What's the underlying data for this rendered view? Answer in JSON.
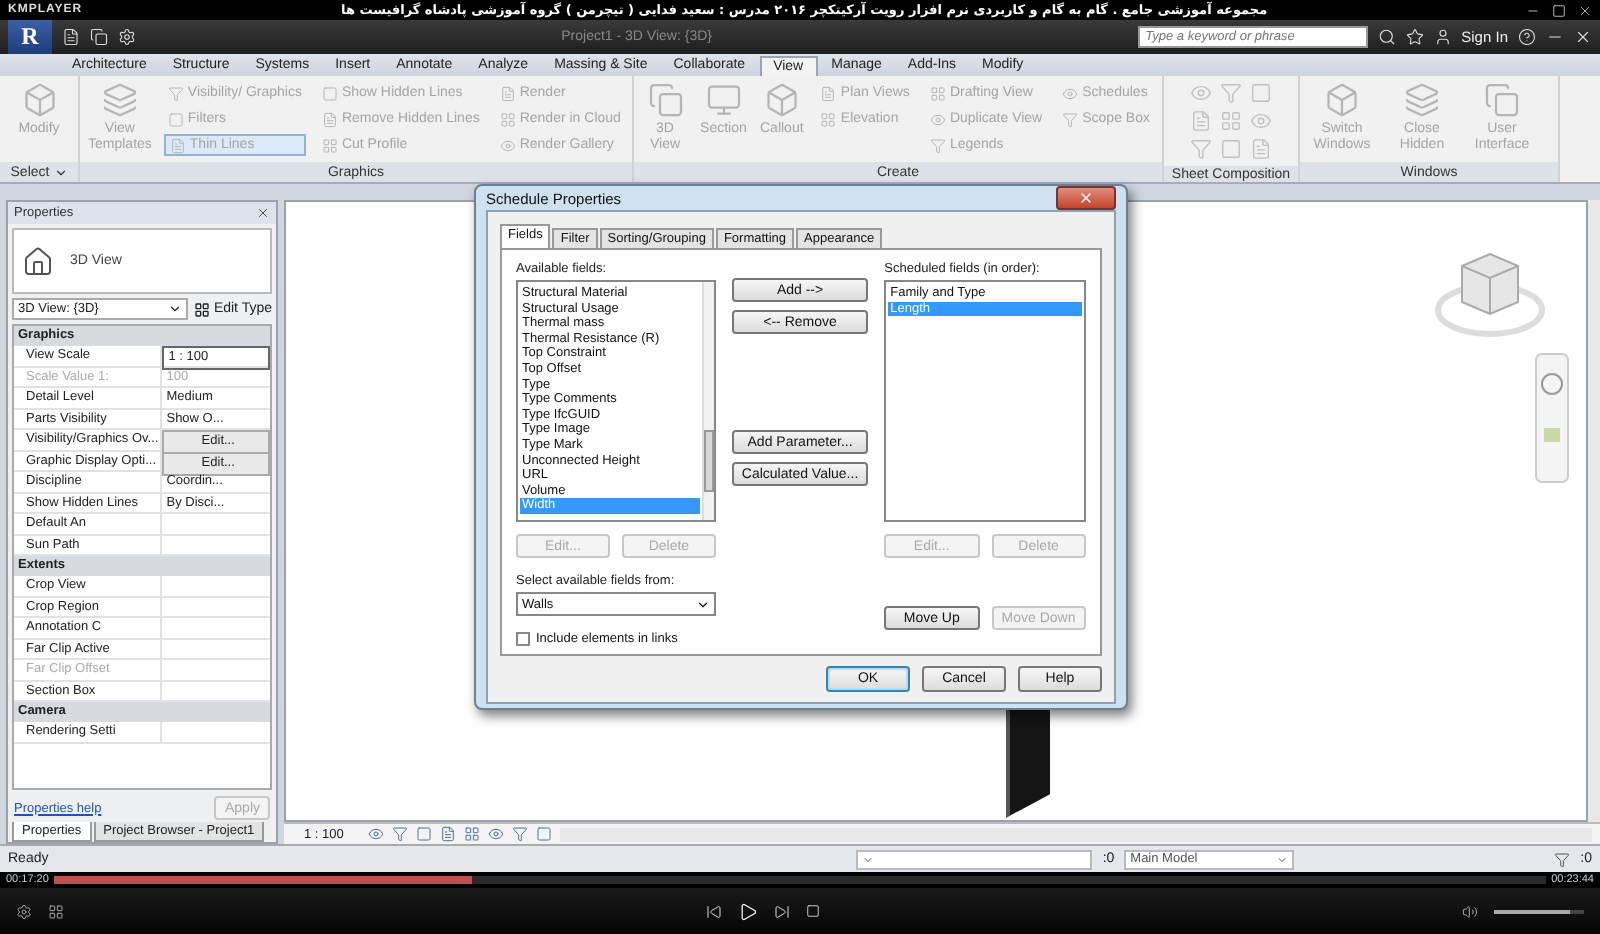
{
  "player": {
    "brand": "KMPLAYER",
    "title": "مجموعه آموزشی جامع . گام به گام و کاربردی نرم افزار رویت آرکیتکچر ۲۰۱۶   مدرس : سعید فدایی ( تیچرمن ) گروه آموزشی پادشاه گرافیست ها",
    "elapsed": "00:17:20",
    "total": "00:23:44",
    "progress": {
      "level": 0.28
    },
    "volume": {
      "level": 0.85
    }
  },
  "app": {
    "menu_letter": "R",
    "document_title": "Project1 - 3D View: {3D}",
    "search": {
      "placeholder": "Type a keyword or phrase"
    },
    "sign_in": "Sign In"
  },
  "tabs": [
    {
      "label": "Architecture",
      "selected": false
    },
    {
      "label": "Structure",
      "selected": false
    },
    {
      "label": "Systems",
      "selected": false
    },
    {
      "label": "Insert",
      "selected": false
    },
    {
      "label": "Annotate",
      "selected": false
    },
    {
      "label": "Analyze",
      "selected": false
    },
    {
      "label": "Massing & Site",
      "selected": false
    },
    {
      "label": "Collaborate",
      "selected": false
    },
    {
      "label": "View",
      "selected": true
    },
    {
      "label": "Manage",
      "selected": false
    },
    {
      "label": "Add-Ins",
      "selected": false
    },
    {
      "label": "Modify",
      "selected": false
    }
  ],
  "ribbon": {
    "panels": [
      {
        "label": "Select",
        "has_menu": true,
        "tools": [
          {
            "kind": "large",
            "items": [
              {
                "label": "Modify",
                "selected": false
              }
            ]
          }
        ]
      },
      {
        "label": "Graphics",
        "has_menu": false,
        "tools": [
          {
            "kind": "large",
            "items": [
              {
                "label": "View Templates",
                "selected": false
              }
            ]
          },
          {
            "kind": "stack",
            "items": [
              {
                "label": "Visibility/ Graphics",
                "selected": false
              },
              {
                "label": "Filters",
                "selected": false
              },
              {
                "label": "Thin  Lines",
                "selected": true
              }
            ]
          },
          {
            "kind": "stack",
            "items": [
              {
                "label": "Show  Hidden Lines",
                "selected": false
              },
              {
                "label": "Remove  Hidden Lines",
                "selected": false
              },
              {
                "label": "Cut  Profile",
                "selected": false
              }
            ]
          },
          {
            "kind": "stack",
            "items": [
              {
                "label": "Render",
                "selected": false
              },
              {
                "label": "Render  in Cloud",
                "selected": false
              },
              {
                "label": "Render  Gallery",
                "selected": false
              }
            ]
          }
        ]
      },
      {
        "label": "Create",
        "has_menu": false,
        "tools": [
          {
            "kind": "large",
            "items": [
              {
                "label": "3D View",
                "selected": false
              }
            ]
          },
          {
            "kind": "large",
            "items": [
              {
                "label": "Section",
                "selected": false
              }
            ]
          },
          {
            "kind": "large",
            "items": [
              {
                "label": "Callout",
                "selected": false
              }
            ]
          },
          {
            "kind": "stack",
            "items": [
              {
                "label": "Plan Views",
                "selected": false
              },
              {
                "label": "Elevation",
                "selected": false
              }
            ]
          },
          {
            "kind": "stack",
            "items": [
              {
                "label": "Drafting  View",
                "selected": false
              },
              {
                "label": "Duplicate  View",
                "selected": false
              },
              {
                "label": "Legends",
                "selected": false
              }
            ]
          },
          {
            "kind": "stack",
            "items": [
              {
                "label": "Schedules",
                "selected": false
              },
              {
                "label": "Scope Box",
                "selected": false
              }
            ]
          }
        ]
      },
      {
        "label": "Sheet Composition",
        "has_menu": false
      },
      {
        "label": "Windows",
        "has_menu": false,
        "tools": [
          {
            "kind": "large",
            "items": [
              {
                "label": "Switch Windows",
                "selected": false
              }
            ]
          },
          {
            "kind": "large",
            "items": [
              {
                "label": "Close Hidden",
                "selected": false
              }
            ]
          },
          {
            "kind": "large",
            "items": [
              {
                "label": "User Interface",
                "selected": false
              }
            ]
          }
        ]
      }
    ]
  },
  "properties": {
    "title": "Properties",
    "type_name": "3D View",
    "instance": "3D View: {3D}",
    "edit_type": "Edit Type",
    "groups": [
      {
        "label": "Graphics",
        "rows": [
          {
            "label": "View Scale",
            "value": "1 : 100",
            "kind": "field",
            "disabled": false
          },
          {
            "label": "Scale Value    1:",
            "value": "100",
            "kind": "text",
            "disabled": true
          },
          {
            "label": "Detail Level",
            "value": "Medium",
            "kind": "text",
            "disabled": false
          },
          {
            "label": "Parts Visibility",
            "value": "Show O...",
            "kind": "text",
            "disabled": false
          },
          {
            "label": "Visibility/Graphics Ov...",
            "value": "Edit...",
            "kind": "button",
            "disabled": false
          },
          {
            "label": "Graphic Display Opti...",
            "value": "Edit...",
            "kind": "button",
            "disabled": false
          },
          {
            "label": "Discipline",
            "value": "Coordin...",
            "kind": "text",
            "disabled": false
          },
          {
            "label": "Show Hidden Lines",
            "value": "By Disci...",
            "kind": "text",
            "disabled": false
          },
          {
            "label": "Default An",
            "disabled": false
          },
          {
            "label": "Sun Path",
            "disabled": false
          }
        ]
      },
      {
        "label": "Extents",
        "rows": [
          {
            "label": "Crop View",
            "disabled": false
          },
          {
            "label": "Crop Region",
            "disabled": false
          },
          {
            "label": "Annotation C",
            "disabled": false
          },
          {
            "label": "Far Clip Active",
            "disabled": false
          },
          {
            "label": "Far Clip Offset",
            "disabled": true
          },
          {
            "label": "Section Box",
            "disabled": false
          }
        ]
      },
      {
        "label": "Camera",
        "rows": [
          {
            "label": "Rendering Setti",
            "disabled": false
          }
        ]
      }
    ],
    "help_link": "Properties help",
    "apply": {
      "label": "Apply",
      "disabled": true
    },
    "bottom_tabs": [
      {
        "label": "Properties",
        "selected": true
      },
      {
        "label": "Project Browser - Project1",
        "selected": false
      }
    ]
  },
  "view": {
    "scale": "1 : 100"
  },
  "status_bar": {
    "message": "Ready",
    "count": ":0",
    "model": "Main Model",
    "filter_count": ":0"
  },
  "dialog": {
    "title": "Schedule Properties",
    "tabs": [
      {
        "label": "Fields",
        "selected": true
      },
      {
        "label": "Filter",
        "selected": false
      },
      {
        "label": "Sorting/Grouping",
        "selected": false
      },
      {
        "label": "Formatting",
        "selected": false
      },
      {
        "label": "Appearance",
        "selected": false
      }
    ],
    "available_label": "Available fields:",
    "available": [
      {
        "label": "Structural Material",
        "selected": false
      },
      {
        "label": "Structural Usage",
        "selected": false
      },
      {
        "label": "Thermal mass",
        "selected": false
      },
      {
        "label": "Thermal Resistance (R)",
        "selected": false
      },
      {
        "label": "Top Constraint",
        "selected": false
      },
      {
        "label": "Top Offset",
        "selected": false
      },
      {
        "label": "Type",
        "selected": false
      },
      {
        "label": "Type Comments",
        "selected": false
      },
      {
        "label": "Type IfcGUID",
        "selected": false
      },
      {
        "label": "Type Image",
        "selected": false
      },
      {
        "label": "Type Mark",
        "selected": false
      },
      {
        "label": "Unconnected Height",
        "selected": false
      },
      {
        "label": "URL",
        "selected": false
      },
      {
        "label": "Volume",
        "selected": false
      },
      {
        "label": "Width",
        "selected": true
      }
    ],
    "available_buttons": [
      {
        "label": "Edit...",
        "disabled": true
      },
      {
        "label": "Delete",
        "disabled": true
      }
    ],
    "middle_buttons": [
      {
        "label": "Add -->",
        "disabled": false
      },
      {
        "label": "<-- Remove",
        "disabled": false
      },
      {
        "label": "Add Parameter...",
        "disabled": false
      },
      {
        "label": "Calculated Value...",
        "disabled": false
      }
    ],
    "scheduled_label": "Scheduled fields (in order):",
    "scheduled": [
      {
        "label": "Family and Type",
        "selected": false
      },
      {
        "label": "Length",
        "selected": true
      }
    ],
    "scheduled_buttons": [
      {
        "label": "Edit...",
        "disabled": true
      },
      {
        "label": "Delete",
        "disabled": true
      }
    ],
    "source_label": "Select available fields from:",
    "source": "Walls",
    "include_links": {
      "label": "Include elements in links",
      "checked": false
    },
    "move_buttons": [
      {
        "label": "Move Up",
        "disabled": false
      },
      {
        "label": "Move Down",
        "disabled": true
      }
    ],
    "footer_buttons": [
      {
        "label": "OK",
        "disabled": false
      },
      {
        "label": "Cancel",
        "disabled": false
      },
      {
        "label": "Help",
        "disabled": false
      }
    ]
  }
}
